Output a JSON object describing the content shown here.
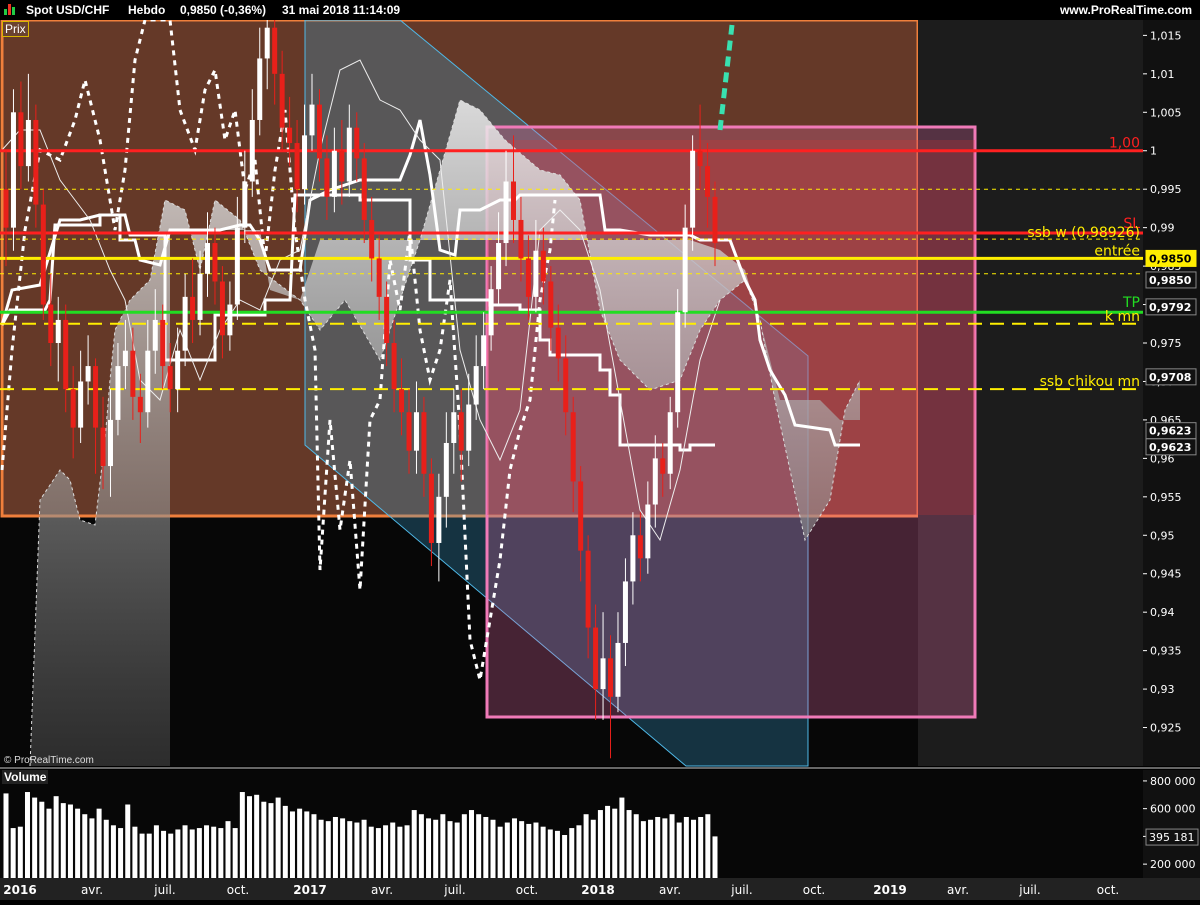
{
  "header": {
    "symbol": "Spot USD/CHF",
    "period": "Hebdo",
    "price": "0,9850 (-0,36%)",
    "datetime": "31 mai 2018 11:14:09",
    "source": "www.ProRealTime.com"
  },
  "panels": {
    "price_label": "Prix",
    "volume_label": "Volume",
    "watermark": "© ProRealTime.com"
  },
  "colors": {
    "bullish": "#ffffff",
    "bearish": "#e8201a",
    "orange_zone": "#d8703a",
    "pink_zone": "#f07ab8",
    "channel": "#4fb9e8",
    "entry": "#ffee00",
    "tp": "#22dd22",
    "sl": "#ff2020",
    "kijun_projection": "#39e0b0"
  },
  "chart_data": {
    "type": "candlestick",
    "title": "Spot USD/CHF Hebdo",
    "ylim": [
      0.92,
      1.017
    ],
    "y_ticks": [
      {
        "v": 1.015,
        "t": "1,015"
      },
      {
        "v": 1.01,
        "t": "1,01"
      },
      {
        "v": 1.005,
        "t": "1,005"
      },
      {
        "v": 1.0,
        "t": "1"
      },
      {
        "v": 0.995,
        "t": "0,995"
      },
      {
        "v": 0.99,
        "t": "0,99"
      },
      {
        "v": 0.985,
        "t": "0,985"
      },
      {
        "v": 0.98,
        "t": "0,98"
      },
      {
        "v": 0.975,
        "t": "0,975"
      },
      {
        "v": 0.97,
        "t": "0,97"
      },
      {
        "v": 0.965,
        "t": "0,965"
      },
      {
        "v": 0.96,
        "t": "0,96"
      },
      {
        "v": 0.955,
        "t": "0,955"
      },
      {
        "v": 0.95,
        "t": "0,95"
      },
      {
        "v": 0.945,
        "t": "0,945"
      },
      {
        "v": 0.94,
        "t": "0,94"
      },
      {
        "v": 0.935,
        "t": "0,935"
      },
      {
        "v": 0.93,
        "t": "0,93"
      },
      {
        "v": 0.925,
        "t": "0,925"
      }
    ],
    "x_ticks": [
      "2016",
      "avr.",
      "juil.",
      "oct.",
      "2017",
      "avr.",
      "juil.",
      "oct.",
      "2018",
      "avr.",
      "juil.",
      "oct.",
      "2019",
      "avr.",
      "juil.",
      "oct."
    ],
    "x_tick_bold": [
      true,
      false,
      false,
      false,
      true,
      false,
      false,
      false,
      true,
      false,
      false,
      false,
      true,
      false,
      false,
      false
    ],
    "horizontal_lines": [
      {
        "label": "1,00",
        "value": 1.0,
        "color": "#ff2020",
        "style": "solid"
      },
      {
        "label": "SL",
        "value": 0.9893,
        "color": "#ff2020",
        "style": "solid"
      },
      {
        "label": "ssb w (0,98926)",
        "value": 0.9893,
        "color": "#ffee00",
        "style": "text"
      },
      {
        "label": "entrée",
        "value": 0.986,
        "color": "#ffee00",
        "style": "solid"
      },
      {
        "label": "TP",
        "value": 0.979,
        "color": "#22dd22",
        "style": "solid"
      },
      {
        "label": "k mn",
        "value": 0.9775,
        "color": "#ffee00",
        "style": "dashed"
      },
      {
        "label": "ssb chikou mn",
        "value": 0.969,
        "color": "#ffee00",
        "style": "dashed"
      }
    ],
    "price_badges": [
      {
        "text": "0,9850",
        "value": 0.986,
        "style": "yellow"
      },
      {
        "text": "0,9850",
        "value": 0.9832,
        "style": "white"
      },
      {
        "text": "0,9792",
        "value": 0.9797,
        "style": "white"
      },
      {
        "text": "0,9708",
        "value": 0.9706,
        "style": "white"
      },
      {
        "text": "0,9623",
        "value": 0.9636,
        "style": "white"
      },
      {
        "text": "0,9623",
        "value": 0.9615,
        "style": "white"
      }
    ],
    "candles": [
      {
        "o": 0.995,
        "c": 0.99,
        "h": 1.0,
        "l": 0.985
      },
      {
        "o": 0.99,
        "c": 1.005,
        "h": 1.008,
        "l": 0.987
      },
      {
        "o": 1.005,
        "c": 0.998,
        "h": 1.009,
        "l": 0.995
      },
      {
        "o": 0.998,
        "c": 1.004,
        "h": 1.01,
        "l": 0.996
      },
      {
        "o": 1.004,
        "c": 0.993,
        "h": 1.006,
        "l": 0.99
      },
      {
        "o": 0.993,
        "c": 0.98,
        "h": 0.995,
        "l": 0.978
      },
      {
        "o": 0.98,
        "c": 0.975,
        "h": 0.984,
        "l": 0.972
      },
      {
        "o": 0.975,
        "c": 0.978,
        "h": 0.981,
        "l": 0.97
      },
      {
        "o": 0.978,
        "c": 0.969,
        "h": 0.98,
        "l": 0.966
      },
      {
        "o": 0.969,
        "c": 0.964,
        "h": 0.972,
        "l": 0.96
      },
      {
        "o": 0.964,
        "c": 0.97,
        "h": 0.974,
        "l": 0.962
      },
      {
        "o": 0.97,
        "c": 0.972,
        "h": 0.976,
        "l": 0.967
      },
      {
        "o": 0.972,
        "c": 0.964,
        "h": 0.973,
        "l": 0.958
      },
      {
        "o": 0.964,
        "c": 0.959,
        "h": 0.968,
        "l": 0.956
      },
      {
        "o": 0.959,
        "c": 0.965,
        "h": 0.969,
        "l": 0.955
      },
      {
        "o": 0.965,
        "c": 0.972,
        "h": 0.975,
        "l": 0.963
      },
      {
        "o": 0.972,
        "c": 0.974,
        "h": 0.978,
        "l": 0.969
      },
      {
        "o": 0.974,
        "c": 0.968,
        "h": 0.977,
        "l": 0.965
      },
      {
        "o": 0.968,
        "c": 0.966,
        "h": 0.971,
        "l": 0.962
      },
      {
        "o": 0.966,
        "c": 0.974,
        "h": 0.978,
        "l": 0.964
      },
      {
        "o": 0.974,
        "c": 0.978,
        "h": 0.982,
        "l": 0.971
      },
      {
        "o": 0.978,
        "c": 0.972,
        "h": 0.98,
        "l": 0.969
      },
      {
        "o": 0.972,
        "c": 0.969,
        "h": 0.975,
        "l": 0.966
      },
      {
        "o": 0.969,
        "c": 0.974,
        "h": 0.977,
        "l": 0.966
      },
      {
        "o": 0.974,
        "c": 0.981,
        "h": 0.984,
        "l": 0.972
      },
      {
        "o": 0.981,
        "c": 0.978,
        "h": 0.986,
        "l": 0.975
      },
      {
        "o": 0.978,
        "c": 0.984,
        "h": 0.987,
        "l": 0.976
      },
      {
        "o": 0.984,
        "c": 0.988,
        "h": 0.992,
        "l": 0.981
      },
      {
        "o": 0.988,
        "c": 0.983,
        "h": 0.99,
        "l": 0.98
      },
      {
        "o": 0.983,
        "c": 0.976,
        "h": 0.985,
        "l": 0.973
      },
      {
        "o": 0.976,
        "c": 0.98,
        "h": 0.983,
        "l": 0.974
      },
      {
        "o": 0.98,
        "c": 0.99,
        "h": 0.994,
        "l": 0.978
      },
      {
        "o": 0.99,
        "c": 0.996,
        "h": 1.0,
        "l": 0.988
      },
      {
        "o": 0.996,
        "c": 1.004,
        "h": 1.008,
        "l": 0.994
      },
      {
        "o": 1.004,
        "c": 1.012,
        "h": 1.016,
        "l": 1.002
      },
      {
        "o": 1.012,
        "c": 1.016,
        "h": 1.018,
        "l": 1.008
      },
      {
        "o": 1.016,
        "c": 1.01,
        "h": 1.018,
        "l": 1.006
      },
      {
        "o": 1.01,
        "c": 1.003,
        "h": 1.013,
        "l": 1.0
      },
      {
        "o": 1.003,
        "c": 1.001,
        "h": 1.007,
        "l": 0.998
      },
      {
        "o": 1.001,
        "c": 0.995,
        "h": 1.004,
        "l": 0.992
      },
      {
        "o": 0.995,
        "c": 1.002,
        "h": 1.006,
        "l": 0.993
      },
      {
        "o": 1.002,
        "c": 1.006,
        "h": 1.01,
        "l": 1.0
      },
      {
        "o": 1.006,
        "c": 0.999,
        "h": 1.008,
        "l": 0.996
      },
      {
        "o": 0.999,
        "c": 0.994,
        "h": 1.002,
        "l": 0.991
      },
      {
        "o": 0.994,
        "c": 1.0,
        "h": 1.003,
        "l": 0.992
      },
      {
        "o": 1.0,
        "c": 0.996,
        "h": 1.004,
        "l": 0.993
      },
      {
        "o": 0.996,
        "c": 1.003,
        "h": 1.006,
        "l": 0.994
      },
      {
        "o": 1.003,
        "c": 0.999,
        "h": 1.005,
        "l": 0.996
      },
      {
        "o": 0.999,
        "c": 0.991,
        "h": 1.001,
        "l": 0.988
      },
      {
        "o": 0.991,
        "c": 0.986,
        "h": 0.994,
        "l": 0.983
      },
      {
        "o": 0.986,
        "c": 0.981,
        "h": 0.989,
        "l": 0.978
      },
      {
        "o": 0.981,
        "c": 0.975,
        "h": 0.983,
        "l": 0.972
      },
      {
        "o": 0.975,
        "c": 0.969,
        "h": 0.978,
        "l": 0.966
      },
      {
        "o": 0.969,
        "c": 0.966,
        "h": 0.973,
        "l": 0.963
      },
      {
        "o": 0.966,
        "c": 0.961,
        "h": 0.969,
        "l": 0.958
      },
      {
        "o": 0.961,
        "c": 0.966,
        "h": 0.97,
        "l": 0.958
      },
      {
        "o": 0.966,
        "c": 0.958,
        "h": 0.968,
        "l": 0.955
      },
      {
        "o": 0.958,
        "c": 0.949,
        "h": 0.96,
        "l": 0.946
      },
      {
        "o": 0.949,
        "c": 0.955,
        "h": 0.958,
        "l": 0.944
      },
      {
        "o": 0.955,
        "c": 0.962,
        "h": 0.966,
        "l": 0.951
      },
      {
        "o": 0.962,
        "c": 0.966,
        "h": 0.969,
        "l": 0.958
      },
      {
        "o": 0.966,
        "c": 0.961,
        "h": 0.969,
        "l": 0.957
      },
      {
        "o": 0.961,
        "c": 0.967,
        "h": 0.971,
        "l": 0.959
      },
      {
        "o": 0.967,
        "c": 0.972,
        "h": 0.976,
        "l": 0.965
      },
      {
        "o": 0.972,
        "c": 0.976,
        "h": 0.979,
        "l": 0.969
      },
      {
        "o": 0.976,
        "c": 0.982,
        "h": 0.985,
        "l": 0.974
      },
      {
        "o": 0.982,
        "c": 0.988,
        "h": 0.992,
        "l": 0.98
      },
      {
        "o": 0.988,
        "c": 0.996,
        "h": 1.0,
        "l": 0.985
      },
      {
        "o": 0.996,
        "c": 0.991,
        "h": 1.002,
        "l": 0.988
      },
      {
        "o": 0.991,
        "c": 0.986,
        "h": 0.994,
        "l": 0.983
      },
      {
        "o": 0.986,
        "c": 0.981,
        "h": 0.989,
        "l": 0.978
      },
      {
        "o": 0.981,
        "c": 0.987,
        "h": 0.991,
        "l": 0.979
      },
      {
        "o": 0.987,
        "c": 0.983,
        "h": 0.99,
        "l": 0.98
      },
      {
        "o": 0.983,
        "c": 0.977,
        "h": 0.985,
        "l": 0.974
      },
      {
        "o": 0.977,
        "c": 0.973,
        "h": 0.98,
        "l": 0.97
      },
      {
        "o": 0.973,
        "c": 0.966,
        "h": 0.976,
        "l": 0.963
      },
      {
        "o": 0.966,
        "c": 0.957,
        "h": 0.968,
        "l": 0.953
      },
      {
        "o": 0.957,
        "c": 0.948,
        "h": 0.959,
        "l": 0.944
      },
      {
        "o": 0.948,
        "c": 0.938,
        "h": 0.95,
        "l": 0.934
      },
      {
        "o": 0.938,
        "c": 0.93,
        "h": 0.941,
        "l": 0.926
      },
      {
        "o": 0.93,
        "c": 0.934,
        "h": 0.94,
        "l": 0.926
      },
      {
        "o": 0.934,
        "c": 0.929,
        "h": 0.937,
        "l": 0.921
      },
      {
        "o": 0.929,
        "c": 0.936,
        "h": 0.94,
        "l": 0.927
      },
      {
        "o": 0.936,
        "c": 0.944,
        "h": 0.947,
        "l": 0.933
      },
      {
        "o": 0.944,
        "c": 0.95,
        "h": 0.953,
        "l": 0.941
      },
      {
        "o": 0.95,
        "c": 0.947,
        "h": 0.953,
        "l": 0.944
      },
      {
        "o": 0.947,
        "c": 0.954,
        "h": 0.957,
        "l": 0.945
      },
      {
        "o": 0.954,
        "c": 0.96,
        "h": 0.963,
        "l": 0.951
      },
      {
        "o": 0.96,
        "c": 0.958,
        "h": 0.962,
        "l": 0.955
      },
      {
        "o": 0.958,
        "c": 0.966,
        "h": 0.968,
        "l": 0.956
      },
      {
        "o": 0.966,
        "c": 0.979,
        "h": 0.982,
        "l": 0.964
      },
      {
        "o": 0.979,
        "c": 0.99,
        "h": 0.993,
        "l": 0.977
      },
      {
        "o": 0.99,
        "c": 1.0,
        "h": 1.002,
        "l": 0.987
      },
      {
        "o": 1.0,
        "c": 0.998,
        "h": 1.006,
        "l": 0.995
      },
      {
        "o": 0.998,
        "c": 0.994,
        "h": 1.001,
        "l": 0.99
      },
      {
        "o": 0.994,
        "c": 0.988,
        "h": 0.996,
        "l": 0.985
      }
    ],
    "volume": {
      "ylim": [
        100000,
        850000
      ],
      "y_ticks": [
        {
          "v": 800000,
          "t": "800 000"
        },
        {
          "v": 600000,
          "t": "600 000"
        },
        {
          "v": 400000,
          "t": "400 000"
        },
        {
          "v": 200000,
          "t": "200 000"
        }
      ],
      "last_label": "395 181",
      "last_value": 395181,
      "values": [
        710000,
        460000,
        470000,
        720000,
        680000,
        650000,
        600000,
        690000,
        640000,
        630000,
        600000,
        560000,
        530000,
        600000,
        520000,
        480000,
        460000,
        630000,
        470000,
        420000,
        420000,
        480000,
        440000,
        420000,
        450000,
        480000,
        450000,
        460000,
        480000,
        470000,
        460000,
        510000,
        460000,
        720000,
        690000,
        700000,
        650000,
        640000,
        680000,
        620000,
        580000,
        600000,
        580000,
        560000,
        520000,
        510000,
        540000,
        530000,
        510000,
        500000,
        520000,
        470000,
        460000,
        480000,
        500000,
        470000,
        480000,
        590000,
        560000,
        530000,
        520000,
        560000,
        510000,
        500000,
        560000,
        590000,
        560000,
        540000,
        520000,
        470000,
        500000,
        530000,
        510000,
        490000,
        500000,
        470000,
        450000,
        440000,
        410000,
        460000,
        480000,
        560000,
        520000,
        590000,
        620000,
        600000,
        680000,
        590000,
        560000,
        510000,
        520000,
        540000,
        530000,
        560000,
        500000,
        540000,
        520000,
        540000,
        560000,
        400000
      ]
    }
  }
}
